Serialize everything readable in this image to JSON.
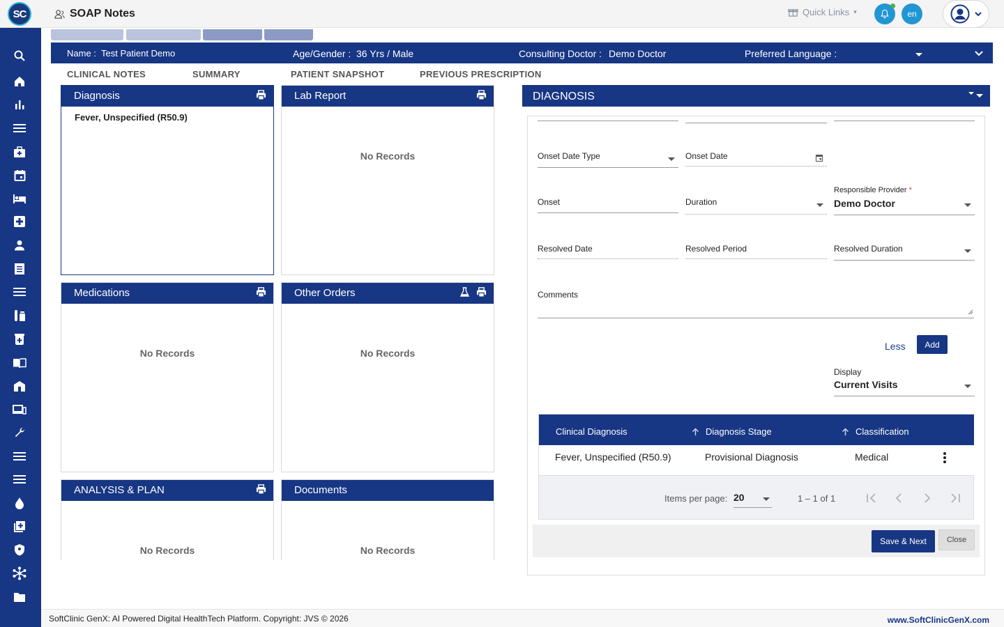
{
  "header": {
    "logo_text": "SC",
    "title": "SOAP Notes",
    "quick_links": "Quick Links",
    "language": "en"
  },
  "sidebar": {
    "items": [
      "search-icon",
      "home-icon",
      "bar-chart-icon",
      "menu-icon",
      "medical-bag-icon",
      "calendar-icon",
      "bed-icon",
      "medical-plus-icon",
      "person-icon",
      "receipt-icon",
      "menu-icon",
      "lab-icon",
      "pill-icon",
      "book-icon",
      "building-icon",
      "devices-icon",
      "wrench-icon",
      "menu-icon",
      "menu-icon",
      "drop-icon",
      "add-box-icon",
      "shield-icon",
      "hub-icon",
      "folder-icon"
    ]
  },
  "patient": {
    "name_label": "Name :",
    "name": "Test Patient Demo",
    "age_label": "Age/Gender :",
    "age": "36 Yrs / Male",
    "doctor_label": "Consulting Doctor :",
    "doctor": "Demo Doctor",
    "lang_label": "Preferred Language :"
  },
  "subtabs": [
    "CLINICAL NOTES",
    "SUMMARY",
    "PATIENT SNAPSHOT",
    "PREVIOUS PRESCRIPTION"
  ],
  "panels": {
    "diagnosis": {
      "title": "Diagnosis",
      "item": "Fever, Unspecified (R50.9)"
    },
    "lab_report": {
      "title": "Lab Report",
      "empty": "No Records"
    },
    "medications": {
      "title": "Medications",
      "empty": "No Records"
    },
    "other_orders": {
      "title": "Other Orders",
      "empty": "No Records"
    },
    "analysis": {
      "title": "ANALYSIS & PLAN",
      "empty": "No Records"
    },
    "documents": {
      "title": "Documents",
      "empty": "No Records"
    }
  },
  "dx_form": {
    "title": "DIAGNOSIS",
    "onset_date_type": "Onset Date Type",
    "onset_date": "Onset Date",
    "onset": "Onset",
    "duration": "Duration",
    "responsible_provider": "Responsible Provider",
    "required_mark": "*",
    "responsible_provider_value": "Demo Doctor",
    "resolved_date": "Resolved Date",
    "resolved_period": "Resolved Period",
    "resolved_duration": "Resolved Duration",
    "comments": "Comments",
    "less": "Less",
    "add": "Add",
    "display_label": "Display",
    "display_value": "Current Visits"
  },
  "table": {
    "headers": [
      "Clinical Diagnosis",
      "Diagnosis Stage",
      "Classification"
    ],
    "rows": [
      [
        "Fever, Unspecified (R50.9)",
        "Provisional Diagnosis",
        "Medical"
      ]
    ],
    "items_per_page_label": "Items per page:",
    "items_per_page": "20",
    "range": "1 – 1 of 1"
  },
  "actions": {
    "save_next": "Save & Next",
    "close": "Close"
  },
  "footer": {
    "left": "SoftClinic GenX: AI Powered Digital HealthTech Platform. Copyright: JVS © 2026",
    "right": "www.SoftClinicGenX.com"
  }
}
